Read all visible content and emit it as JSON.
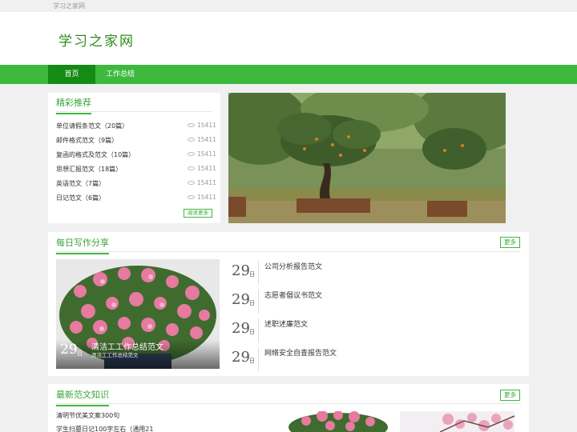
{
  "site": {
    "topbar": "学习之家网",
    "logo": "学习之家网"
  },
  "nav": [
    {
      "label": "首页",
      "active": true
    },
    {
      "label": "工作总结",
      "active": false
    }
  ],
  "recommend": {
    "title": "精彩推荐",
    "items": [
      {
        "name": "单位请假条范文（20篇）",
        "views": "15411"
      },
      {
        "name": "邮件格式范文（9篇）",
        "views": "15411"
      },
      {
        "name": "复函的格式及范文（10篇）",
        "views": "15411"
      },
      {
        "name": "思想汇报范文（18篇）",
        "views": "15411"
      },
      {
        "name": "英语范文（7篇）",
        "views": "15411"
      },
      {
        "name": "日记范文（6篇）",
        "views": "15411"
      }
    ],
    "more_label": "阅读更多"
  },
  "daily": {
    "title": "每日写作分享",
    "more_label": "更多",
    "featured": {
      "day": "29",
      "day_suffix": "日",
      "title": "清洁工工作总结范文",
      "subtitle": "清洁工工作总结范文"
    },
    "items": [
      {
        "day": "29",
        "day_suffix": "日",
        "title": "公司分析报告范文"
      },
      {
        "day": "29",
        "day_suffix": "日",
        "title": "志愿者倡议书范文"
      },
      {
        "day": "29",
        "day_suffix": "日",
        "title": "述职述廉范文"
      },
      {
        "day": "29",
        "day_suffix": "日",
        "title": "网络安全自查报告范文"
      }
    ]
  },
  "latest": {
    "title": "最新范文知识",
    "more_label": "更多",
    "items": [
      {
        "title": "清明节优美文案300句"
      },
      {
        "title": "学生扫墓日记100字左右（通用21"
      }
    ]
  },
  "colors": {
    "brand": "#3db93d",
    "brand_dark": "#158a15",
    "accent_text": "#3aa63a"
  }
}
